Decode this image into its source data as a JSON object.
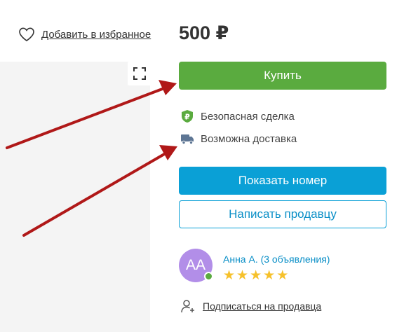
{
  "favorite": {
    "label": "Добавить в избранное",
    "icon": "heart-icon"
  },
  "listing": {
    "price": "500 ₽"
  },
  "actions": {
    "buy_label": "Купить",
    "show_phone_label": "Показать номер",
    "write_seller_label": "Написать продавцу"
  },
  "features": [
    {
      "label": "Безопасная сделка",
      "icon": "safe-deal-shield-icon",
      "color": "#5aab3f"
    },
    {
      "label": "Возможна доставка",
      "icon": "truck-icon",
      "color": "#5e7694"
    }
  ],
  "seller": {
    "initials": "АА",
    "name": "Анна А. (3 объявления)",
    "rating": 5,
    "online": true
  },
  "subscribe": {
    "label": "Подписаться на продавца",
    "icon": "subscribe-user-icon"
  },
  "colors": {
    "buy": "#5aab3f",
    "phone": "#0aa0d6",
    "link": "#0a8fc7",
    "avatar": "#b28ee8",
    "annotation_arrow": "#b01818"
  }
}
